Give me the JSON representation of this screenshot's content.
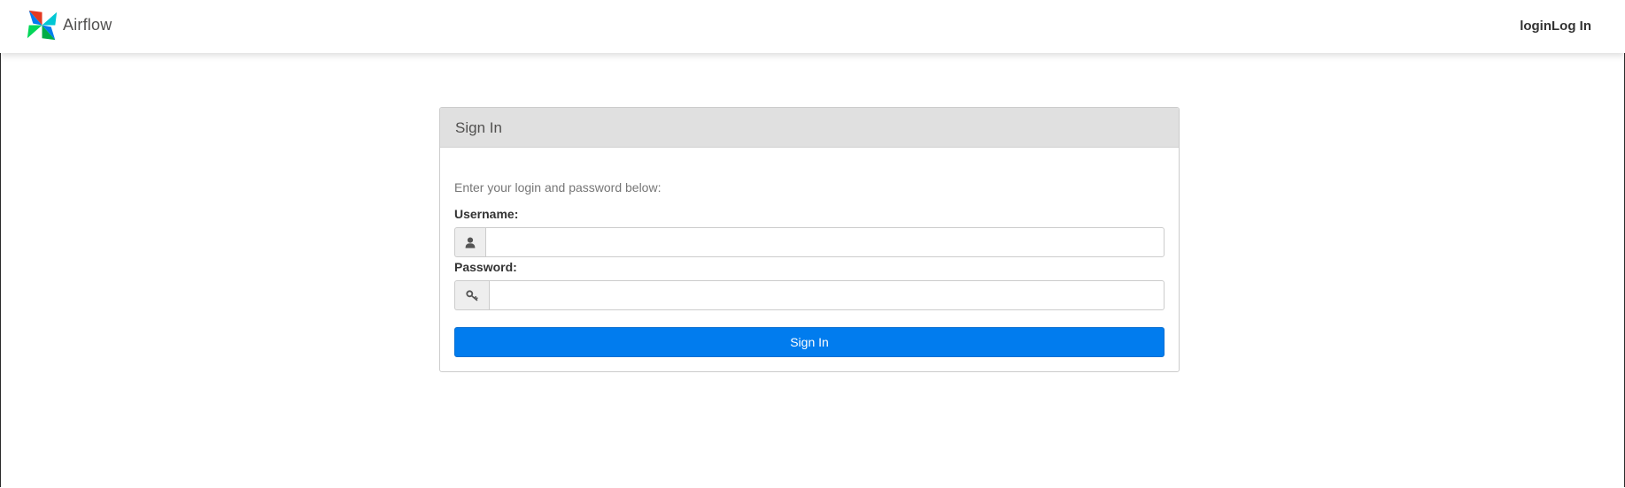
{
  "app": {
    "name": "Airflow",
    "logo_icon": "airflow-pinwheel-icon"
  },
  "navbar": {
    "login_link": "loginLog In"
  },
  "login_panel": {
    "heading": "Sign In",
    "instructions": "Enter your login and password below:",
    "username": {
      "label": "Username:",
      "value": "",
      "placeholder": "",
      "icon": "user-icon"
    },
    "password": {
      "label": "Password:",
      "value": "",
      "placeholder": "",
      "icon": "key-icon"
    },
    "submit_label": "Sign In"
  },
  "colors": {
    "primary_button": "#017cee",
    "panel_heading_bg": "#e0e0e0",
    "logo_red": "#e43921",
    "logo_blue": "#00ad46",
    "logo_green": "#04d659",
    "logo_cyan": "#00c7d4"
  }
}
